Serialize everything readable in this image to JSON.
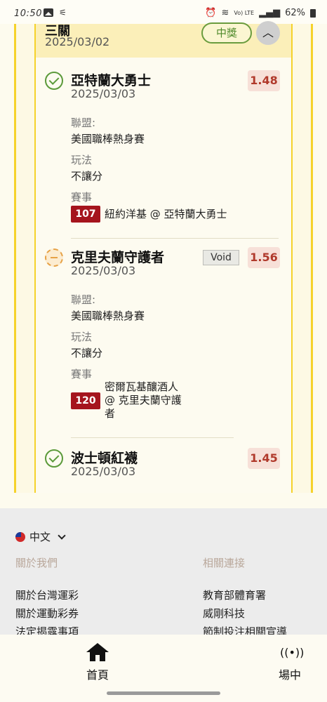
{
  "status_bar": {
    "time": "10:50",
    "battery": "62%",
    "net_label": "Vo) LTE"
  },
  "parlay": {
    "title": "三關",
    "date": "2025/03/02",
    "result_badge": "中獎",
    "collapse_icon": "chevron-up-icon"
  },
  "labels": {
    "league": "聯盟:",
    "play": "玩法",
    "event": "賽事"
  },
  "legs": [
    {
      "status_icon": "check-circle-icon",
      "team": "亞特蘭大勇士",
      "date": "2025/03/03",
      "odds": "1.48",
      "league": "美國職棒熱身賽",
      "play": "不讓分",
      "event_num": "107",
      "event_text": "紐約洋基 @ 亞特蘭大勇士"
    },
    {
      "status_icon": "void-circle-icon",
      "team": "克里夫蘭守護者",
      "date": "2025/03/03",
      "odds": "1.56",
      "tag": "Void",
      "league": "美國職棒熱身賽",
      "play": "不讓分",
      "event_num": "120",
      "event_lines": [
        "密爾瓦基釀酒人",
        "@ 克里夫蘭守護",
        "者"
      ]
    },
    {
      "status_icon": "check-circle-icon",
      "team": "波士頓紅襪",
      "date": "2025/03/03",
      "odds": "1.45"
    }
  ],
  "footer": {
    "language": "中文",
    "about_heading": "關於我們",
    "links_heading": "相關連接",
    "about_links": [
      "關於台灣運彩",
      "關於運動彩券",
      "法定揭露事項"
    ],
    "related_links": [
      "教育部體育署",
      "威剛科技",
      "節制投注相關宣導"
    ]
  },
  "bottom_nav": {
    "home_label": "首頁",
    "live_label": "場中"
  },
  "colors": {
    "accent_yellow": "#f5d22b",
    "odds_red": "#b0392b",
    "event_red": "#a5141d",
    "win_green": "#4f8a2a"
  }
}
